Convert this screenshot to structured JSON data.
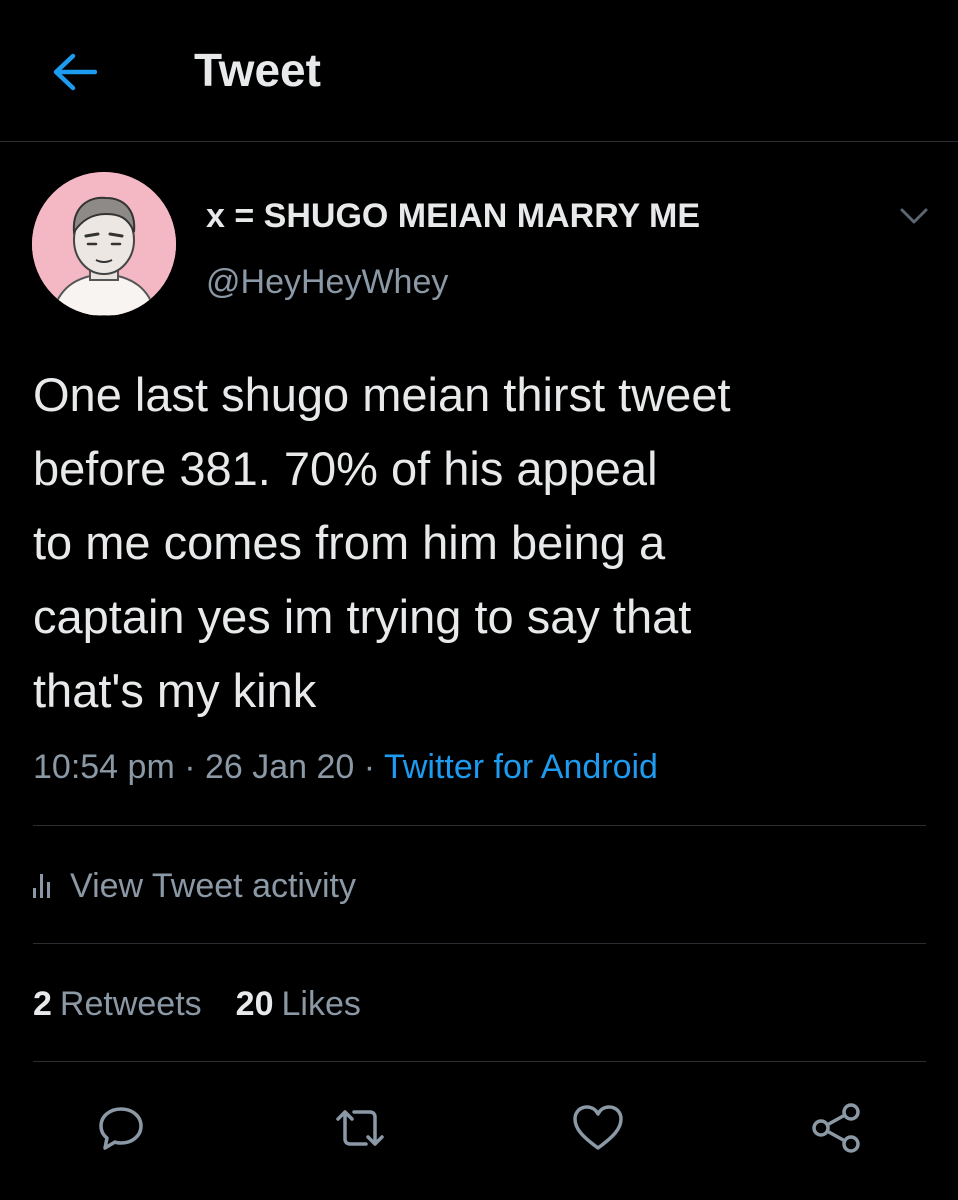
{
  "header": {
    "back_icon": "arrow-left-icon",
    "title": "Tweet"
  },
  "tweet": {
    "display_name": "x = SHUGO MEIAN MARRY ME",
    "handle": "@HeyHeyWhey",
    "text": "One last shugo meian thirst tweet\nbefore 381. 70% of his appeal\nto me comes from him being a\ncaptain yes im trying to say that\nthat's my kink",
    "time": "10:54 pm",
    "date": "26 Jan 20",
    "separator": " · ",
    "source": "Twitter for Android",
    "activity_label": "View Tweet activity",
    "retweets_count": "2",
    "retweets_label": "Retweets",
    "likes_count": "20",
    "likes_label": "Likes"
  },
  "actions": [
    {
      "name": "reply",
      "icon": "speech-bubble-icon"
    },
    {
      "name": "retweet",
      "icon": "retweet-arrows-icon"
    },
    {
      "name": "like",
      "icon": "heart-icon"
    },
    {
      "name": "share",
      "icon": "share-nodes-icon"
    }
  ],
  "colors": {
    "background": "#000000",
    "text_primary": "#e7e9ea",
    "text_secondary": "#8b98a5",
    "accent": "#1d9bf0",
    "divider": "#2a2e33",
    "avatar_bg": "#f3b8c4"
  }
}
